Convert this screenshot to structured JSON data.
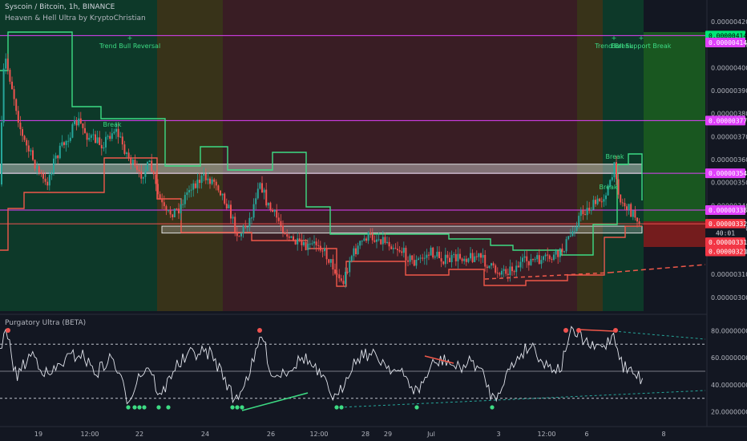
{
  "header": {
    "symbol_line": "Syscoin / Bitcoin, 1h, BINANCE",
    "indicator_line": "Heaven & Hell Ultra by KryptoChristian"
  },
  "oscillator": {
    "title": "Purgatory Ultra (BETA)"
  },
  "colors": {
    "background": "#131722",
    "up": "#26a69a",
    "down": "#ef5350",
    "magenta": "#e040fb",
    "green_line": "#3ddc84",
    "red_line": "#f0584a",
    "osc_line": "#e0e3eb"
  },
  "chart_data": [
    {
      "type": "candlestick",
      "y_ticks": [
        "0.00000420",
        "0.00000410",
        "0.00000400",
        "0.00000390",
        "0.00000380",
        "0.00000370",
        "0.00000360",
        "0.00000350",
        "0.00000340",
        "0.00000330",
        "0.00000320",
        "0.00000310",
        "0.00000300"
      ],
      "ylim": [
        2.94e-06,
        4.26e-06
      ],
      "x_ticks": [
        "19",
        "12:00",
        "22",
        "24",
        "26",
        "12:00",
        "28",
        "29",
        "Jul",
        "3",
        "12:00",
        "6",
        "8"
      ],
      "price_labels": [
        {
          "text": "0.00000414",
          "value": 4.14e-06,
          "color": "#00e676"
        },
        {
          "text": "0.00000414",
          "value": 4.11e-06,
          "color": "#e040fb"
        },
        {
          "text": "0.00000377",
          "value": 3.77e-06,
          "color": "#e040fb"
        },
        {
          "text": "0.00000354",
          "value": 3.54e-06,
          "color": "#e040fb"
        },
        {
          "text": "0.00000338",
          "value": 3.38e-06,
          "color": "#e040fb"
        },
        {
          "text": "0.00000332",
          "value": 3.32e-06,
          "color": "#f23645"
        },
        {
          "text": "40:01",
          "value": 3.28e-06,
          "color": "#131722"
        },
        {
          "text": "0.00000331",
          "value": 3.24e-06,
          "color": "#f23645"
        },
        {
          "text": "0.00000321",
          "value": 3.2e-06,
          "color": "#f23645"
        }
      ],
      "horizontal_lines": [
        4.14e-06,
        3.77e-06,
        3.54e-06,
        3.38e-06,
        3.32e-06
      ],
      "zones": [
        {
          "y1": 3.58e-06,
          "y2": 3.54e-06,
          "label": "resistance box"
        },
        {
          "y1": 3.31e-06,
          "y2": 3.28e-06,
          "label": "support box"
        }
      ],
      "annotations": [
        {
          "text": "Trend Bull Reversal",
          "color": "#3ddc84"
        },
        {
          "text": "Trend Break",
          "color": "#3ddc84"
        },
        {
          "text": "Bull Support Break",
          "color": "#3ddc84"
        },
        {
          "text": "Break",
          "color": "#3ddc84"
        },
        {
          "text": "Break",
          "color": "#3ddc84"
        },
        {
          "text": "Break",
          "color": "#3ddc84"
        }
      ]
    },
    {
      "type": "line",
      "name": "Purgatory Ultra (BETA)",
      "y_ticks": [
        "80.00000000",
        "60.00000000",
        "40.00000000",
        "20.00000000"
      ],
      "ylim": [
        15,
        85
      ],
      "levels": [
        70,
        50,
        30
      ],
      "last_value": 43
    }
  ]
}
